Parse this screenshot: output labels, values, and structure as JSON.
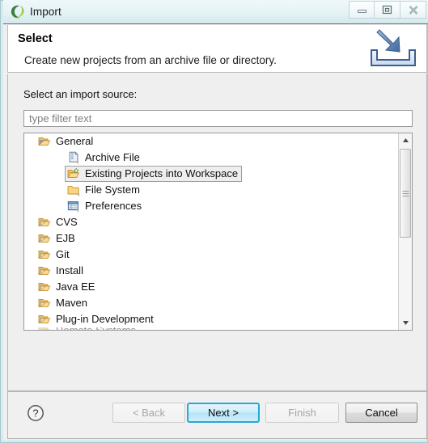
{
  "window": {
    "title": "Import",
    "logo_icon": "eclipse-logo-icon",
    "controls": [
      {
        "name": "minimize-button",
        "icon": "minimize-icon",
        "label": "Minimize"
      },
      {
        "name": "restore-button",
        "icon": "restore-icon",
        "label": "Restore"
      },
      {
        "name": "close-button",
        "icon": "close-icon",
        "label": "Close"
      }
    ]
  },
  "header": {
    "title": "Select",
    "description": "Create new projects from an archive file or directory.",
    "icon": "import-wizard-icon"
  },
  "body": {
    "source_label": "Select an import source:",
    "filter": {
      "value": "",
      "placeholder": "type filter text"
    },
    "tree": [
      {
        "label": "General",
        "level": 0,
        "icon": "open-folder-icon",
        "twisty": "expanded",
        "selected": false
      },
      {
        "label": "Archive File",
        "level": 1,
        "icon": "archive-file-icon",
        "twisty": "none",
        "selected": false
      },
      {
        "label": "Existing Projects into Workspace",
        "level": 1,
        "icon": "existing-projects-icon",
        "twisty": "none",
        "selected": true
      },
      {
        "label": "File System",
        "level": 1,
        "icon": "file-system-folder-icon",
        "twisty": "none",
        "selected": false
      },
      {
        "label": "Preferences",
        "level": 1,
        "icon": "preferences-icon",
        "twisty": "none",
        "selected": false
      },
      {
        "label": "CVS",
        "level": 0,
        "icon": "open-folder-icon",
        "twisty": "collapsed",
        "selected": false
      },
      {
        "label": "EJB",
        "level": 0,
        "icon": "open-folder-icon",
        "twisty": "collapsed",
        "selected": false
      },
      {
        "label": "Git",
        "level": 0,
        "icon": "open-folder-icon",
        "twisty": "collapsed",
        "selected": false
      },
      {
        "label": "Install",
        "level": 0,
        "icon": "open-folder-icon",
        "twisty": "collapsed",
        "selected": false
      },
      {
        "label": "Java EE",
        "level": 0,
        "icon": "open-folder-icon",
        "twisty": "collapsed",
        "selected": false
      },
      {
        "label": "Maven",
        "level": 0,
        "icon": "open-folder-icon",
        "twisty": "collapsed",
        "selected": false
      },
      {
        "label": "Plug-in Development",
        "level": 0,
        "icon": "open-folder-icon",
        "twisty": "collapsed",
        "selected": false
      },
      {
        "label": "Remote Systems",
        "level": 0,
        "icon": "open-folder-icon",
        "twisty": "collapsed",
        "selected": false,
        "clipped": true
      }
    ],
    "scrollbar": {
      "up_icon": "scroll-up-arrow-icon",
      "down_icon": "scroll-down-arrow-icon",
      "thumb_grip_icon": "scrollbar-grip-icon"
    }
  },
  "footer": {
    "help_icon": "help-question-icon",
    "buttons": [
      {
        "name": "back-button",
        "label": "< Back",
        "state": "disabled"
      },
      {
        "name": "next-button",
        "label": "Next >",
        "state": "default"
      },
      {
        "name": "finish-button",
        "label": "Finish",
        "state": "disabled"
      },
      {
        "name": "cancel-button",
        "label": "Cancel",
        "state": "normal"
      }
    ]
  },
  "colors": {
    "titlebar_top": "#eef8fa",
    "titlebar_bottom": "#d4e9ee",
    "frame_border": "#d8ecef",
    "body_bg": "#efefef",
    "default_button_border": "#26a8d8",
    "folder_yellow": "#f5c96a",
    "selection_bg": "#eeeeee"
  }
}
